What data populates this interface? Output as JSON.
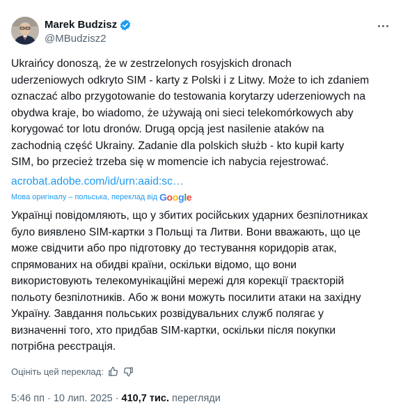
{
  "author": {
    "name": "Marek Budzisz",
    "handle": "@MBudzisz2"
  },
  "menu_icon": "more-horizontal-icon",
  "verified_icon": "verified-badge-icon",
  "post": {
    "original_text": "Ukraińcy donoszą, że w zestrzelonych rosyjskich dronach\nuderzeniowych odkryto SIM - karty z Polski i z Litwy. Może to ich zdaniem\noznaczać albo przygotowanie do testowania korytarzy uderzeniowych na\nobydwa kraje, bo wiadomo, że używają oni sieci telekomórkowych aby\nkorygować tor lotu dronów. Drugą opcją jest nasilenie ataków na\nzachodnią część Ukrainy. Zadanie dla polskich służb - kto kupił karty\nSIM, bo przecież trzeba się w momencie ich nabycia rejestrować.",
    "link_text": "acrobat.adobe.com/id/urn:aaid:sc…",
    "translation_note": "Мова оригіналу – польська, переклад від",
    "translation_provider": "Google",
    "translated_text": "Українці повідомляють, що у збитих російських ударних безпілотниках\nбуло виявлено SIM-картки з Польщі та Литви. Вони вважають, що це\nможе свідчити або про підготовку до тестування коридорів атак,\nспрямованих на обидві країни, оскільки відомо, що вони\nвикористовують телекомунікаційні мережі для корекції траєкторій\nпольоту безпілотників. Або ж вони можуть посилити атаки на західну\nУкраїну. Завдання польських розвідувальних служб полягає у\nвизначенні того, хто придбав SIM-картки, оскільки після покупки\nпотрібна реєстрація.",
    "rate_label": "Оцініть цей переклад:",
    "rate_icons": [
      "thumbs-up-icon",
      "thumbs-down-icon"
    ]
  },
  "meta": {
    "time": "5:46 пп",
    "separator": "·",
    "date": "10 лип. 2025",
    "views_count": "410,7 тис.",
    "views_label": "перегляди"
  },
  "colors": {
    "link": "#1d9bf0",
    "secondary": "#536471",
    "primary": "#0f1419"
  }
}
